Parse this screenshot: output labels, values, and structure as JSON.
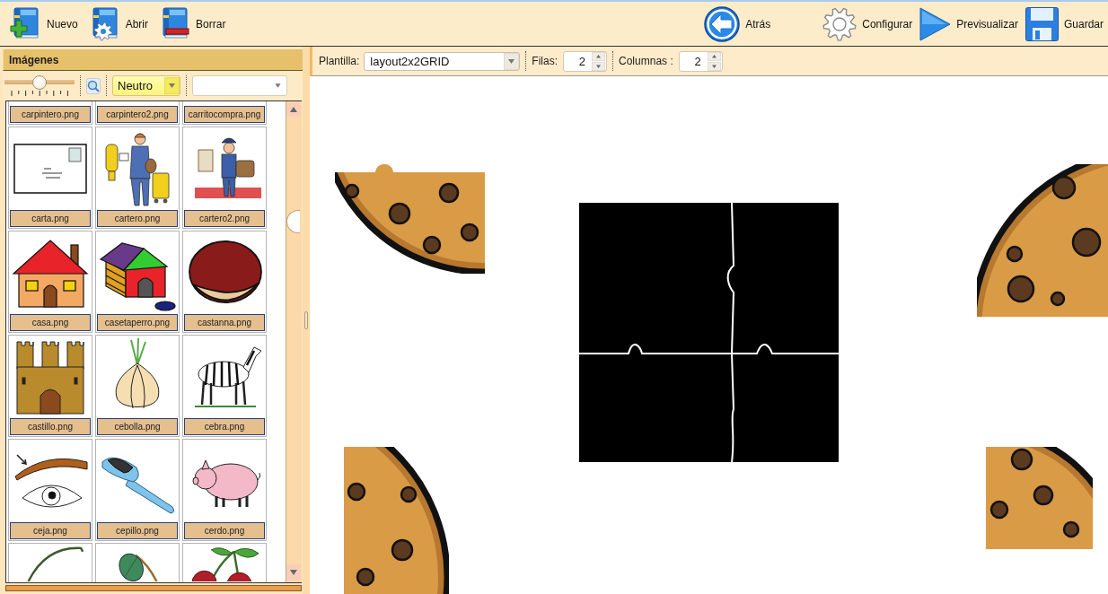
{
  "toolbar": {
    "file_buttons": [
      {
        "kind": "new",
        "label": "Nuevo"
      },
      {
        "kind": "open",
        "label": "Abrir"
      },
      {
        "kind": "delete",
        "label": "Borrar"
      }
    ],
    "nav_buttons": [
      {
        "kind": "back",
        "label": "Atrás"
      }
    ],
    "action_buttons": [
      {
        "kind": "settings",
        "label": "Configurar"
      },
      {
        "kind": "preview",
        "label": "Previsualizar"
      },
      {
        "kind": "save",
        "label": "Guardar"
      }
    ]
  },
  "images_panel": {
    "title": "Imágenes",
    "zoom_slider": {
      "level": 0.5
    },
    "filter": {
      "value": "Neutro"
    },
    "thumbnails": [
      {
        "kind": "label_only",
        "label": "carpintero.png"
      },
      {
        "kind": "label_only",
        "label": "carpintero2.png"
      },
      {
        "kind": "label_only",
        "label": "carritocompra.png"
      },
      {
        "kind": "full",
        "label": "carta.png"
      },
      {
        "kind": "full",
        "label": "cartero.png"
      },
      {
        "kind": "full",
        "label": "cartero2.png"
      },
      {
        "kind": "full",
        "label": "casa.png"
      },
      {
        "kind": "full",
        "label": "casetaperro.png"
      },
      {
        "kind": "full",
        "label": "castanna.png"
      },
      {
        "kind": "full",
        "label": "castillo.png"
      },
      {
        "kind": "full",
        "label": "cebolla.png"
      },
      {
        "kind": "full",
        "label": "cebra.png"
      },
      {
        "kind": "full",
        "label": "ceja.png"
      },
      {
        "kind": "full",
        "label": "cepillo.png"
      },
      {
        "kind": "full",
        "label": "cerdo.png"
      },
      {
        "kind": "image_only"
      },
      {
        "kind": "image_only"
      },
      {
        "kind": "image_only"
      }
    ]
  },
  "template_bar": {
    "template": {
      "label": "Plantilla:",
      "value": "layout2x2GRID"
    },
    "rows": {
      "label": "Filas:",
      "value": "2"
    },
    "columns": {
      "label": "Columnas :",
      "value": "2"
    }
  }
}
